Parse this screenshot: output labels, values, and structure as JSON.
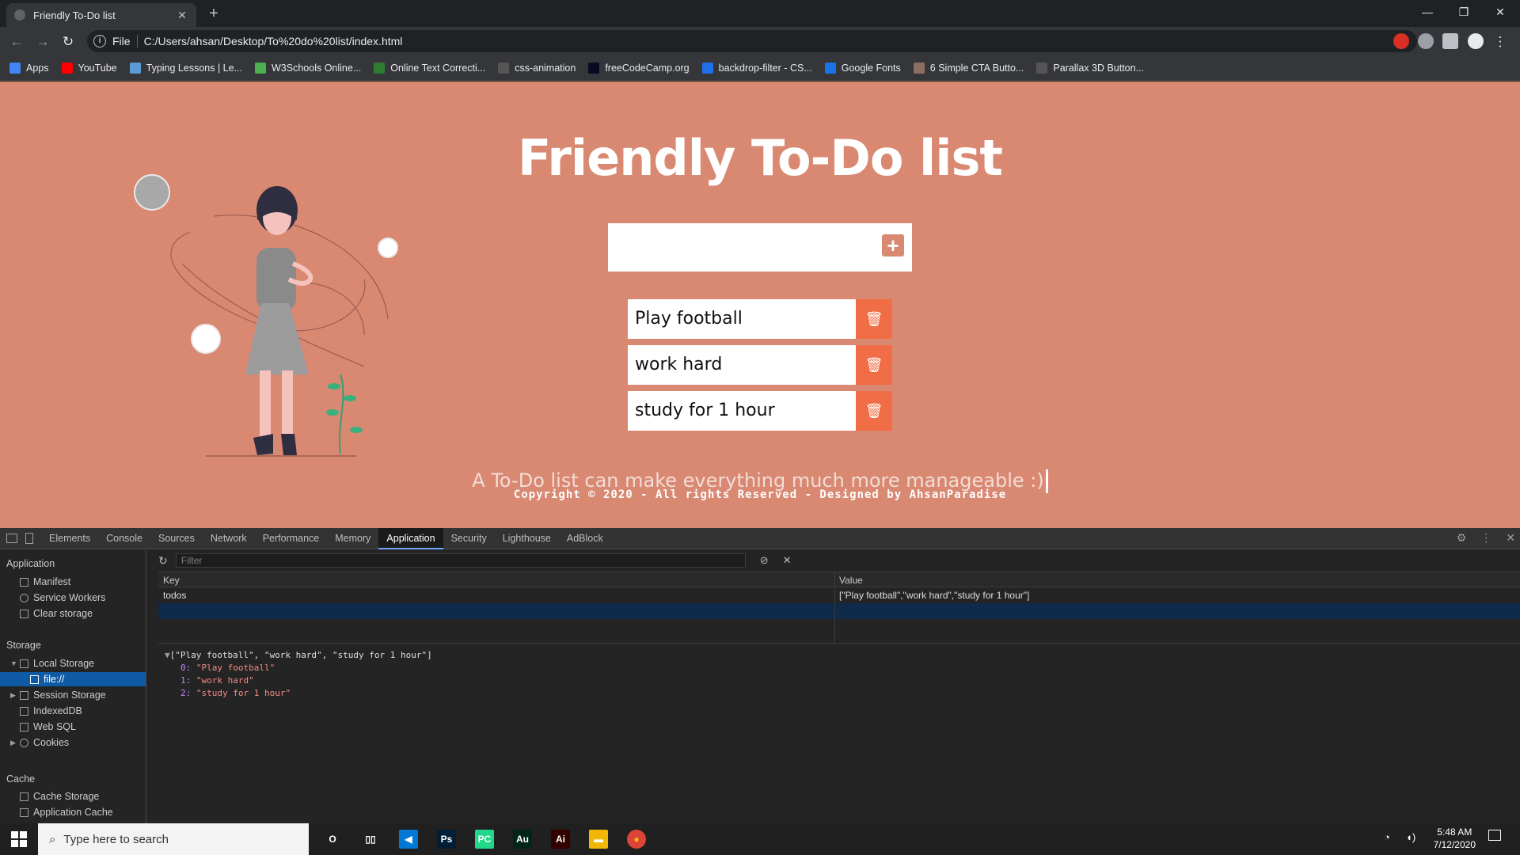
{
  "browser": {
    "tab_title": "Friendly To-Do list",
    "address_prefix": "File",
    "address": "C:/Users/ahsan/Desktop/To%20do%20list/index.html",
    "bookmarks": [
      {
        "label": "Apps",
        "icon": "apps-grid-icon",
        "color": "#4285f4"
      },
      {
        "label": "YouTube",
        "icon": "youtube-icon",
        "color": "#ff0000"
      },
      {
        "label": "Typing Lessons | Le...",
        "icon": "typing-icon",
        "color": "#5a9bd5"
      },
      {
        "label": "W3Schools Online...",
        "icon": "w3schools-icon",
        "color": "#4caf50"
      },
      {
        "label": "Online Text Correcti...",
        "icon": "pen-icon",
        "color": "#2e7d32"
      },
      {
        "label": "css-animation",
        "icon": "codepen-icon",
        "color": "#555555"
      },
      {
        "label": "freeCodeCamp.org",
        "icon": "freecodecamp-icon",
        "color": "#0a0a23"
      },
      {
        "label": "backdrop-filter - CS...",
        "icon": "mdn-icon",
        "color": "#1f6feb"
      },
      {
        "label": "Google Fonts",
        "icon": "google-fonts-icon",
        "color": "#1a73e8"
      },
      {
        "label": "6 Simple CTA Butto...",
        "icon": "cta-icon",
        "color": "#8d6e63"
      },
      {
        "label": "Parallax 3D Button...",
        "icon": "codepen-icon",
        "color": "#555555"
      }
    ]
  },
  "page": {
    "title": "Friendly To-Do list",
    "todos": [
      "Play football",
      "work hard",
      "study for 1 hour"
    ],
    "tagline": "A To-Do list can make everything much more manageable :)",
    "copyright": "Copyright © 2020 - All rights Reserved - Designed by AhsanParadise",
    "bg_color": "#d98872",
    "delete_color": "#f06d46"
  },
  "devtools": {
    "tabs": [
      "Elements",
      "Console",
      "Sources",
      "Network",
      "Performance",
      "Memory",
      "Application",
      "Security",
      "Lighthouse",
      "AdBlock"
    ],
    "active_tab": "Application",
    "sidebar": {
      "application_heading": "Application",
      "application_items": [
        "Manifest",
        "Service Workers",
        "Clear storage"
      ],
      "storage_heading": "Storage",
      "local_storage": "Local Storage",
      "local_storage_child": "file://",
      "storage_items": [
        "Session Storage",
        "IndexedDB",
        "Web SQL",
        "Cookies"
      ],
      "cache_heading": "Cache",
      "cache_items": [
        "Cache Storage",
        "Application Cache"
      ]
    },
    "filter_placeholder": "Filter",
    "table": {
      "key_header": "Key",
      "value_header": "Value",
      "rows": [
        {
          "key": "todos",
          "value": "[\"Play football\",\"work hard\",\"study for 1 hour\"]"
        }
      ]
    },
    "preview": {
      "summary": "[\"Play football\", \"work hard\", \"study for 1 hour\"]",
      "items": [
        {
          "index": "0:",
          "value": "\"Play football\""
        },
        {
          "index": "1:",
          "value": "\"work hard\""
        },
        {
          "index": "2:",
          "value": "\"study for 1 hour\""
        }
      ]
    }
  },
  "taskbar": {
    "search_placeholder": "Type here to search",
    "time": "5:48 AM",
    "date": "7/12/2020",
    "apps": [
      {
        "name": "cortana-icon",
        "label": "O",
        "color": "transparent"
      },
      {
        "name": "task-view-icon",
        "label": "▯▯",
        "color": "transparent"
      },
      {
        "name": "vscode-icon",
        "label": "◀",
        "color": "#0078d4"
      },
      {
        "name": "photoshop-icon",
        "label": "Ps",
        "color": "#001e36"
      },
      {
        "name": "pycharm-icon",
        "label": "PC",
        "color": "#21d789"
      },
      {
        "name": "audition-icon",
        "label": "Au",
        "color": "#00261b"
      },
      {
        "name": "illustrator-icon",
        "label": "Ai",
        "color": "#330000"
      },
      {
        "name": "file-explorer-icon",
        "label": "▬",
        "color": "#f2b705"
      },
      {
        "name": "chrome-icon",
        "label": "●",
        "color": "#db4437"
      }
    ]
  }
}
